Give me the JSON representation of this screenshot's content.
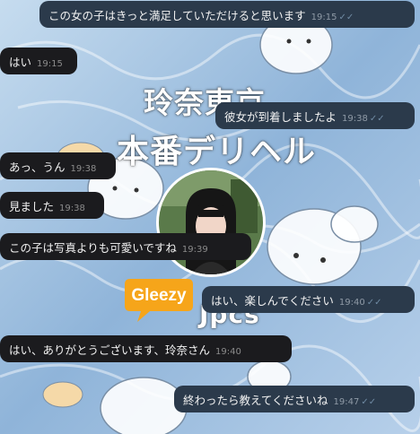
{
  "background": {
    "title_line1": "玲奈東京",
    "title_line2": "本番デリヘル",
    "title_line3": "Jpcs",
    "badge_text": "Gleezy"
  },
  "messages": [
    {
      "dir": "out",
      "text": "この女の子はきっと満足していただけると思います",
      "time": "19:15",
      "read": true
    },
    {
      "dir": "in",
      "text": "はい",
      "time": "19:15"
    },
    {
      "dir": "out",
      "text": "彼女が到着しましたよ",
      "time": "19:38",
      "read": true
    },
    {
      "dir": "in",
      "text": "あっ、うん",
      "time": "19:38"
    },
    {
      "dir": "in",
      "text": "見ました",
      "time": "19:38"
    },
    {
      "dir": "in",
      "text": "この子は写真よりも可愛いですね",
      "time": "19:39"
    },
    {
      "dir": "out",
      "text": "はい、楽しんでください",
      "time": "19:40",
      "read": true
    },
    {
      "dir": "in",
      "text": "はい、ありがとうございます、玲奈さん",
      "time": "19:40"
    },
    {
      "dir": "out",
      "text": "終わったら教えてくださいね",
      "time": "19:47",
      "read": true
    }
  ],
  "colors": {
    "incoming": "#1b1b1e",
    "outgoing": "#2b3a4b",
    "wallpaper": "#9fc0e2"
  },
  "icons": {
    "read_receipt": "double-check-icon"
  }
}
